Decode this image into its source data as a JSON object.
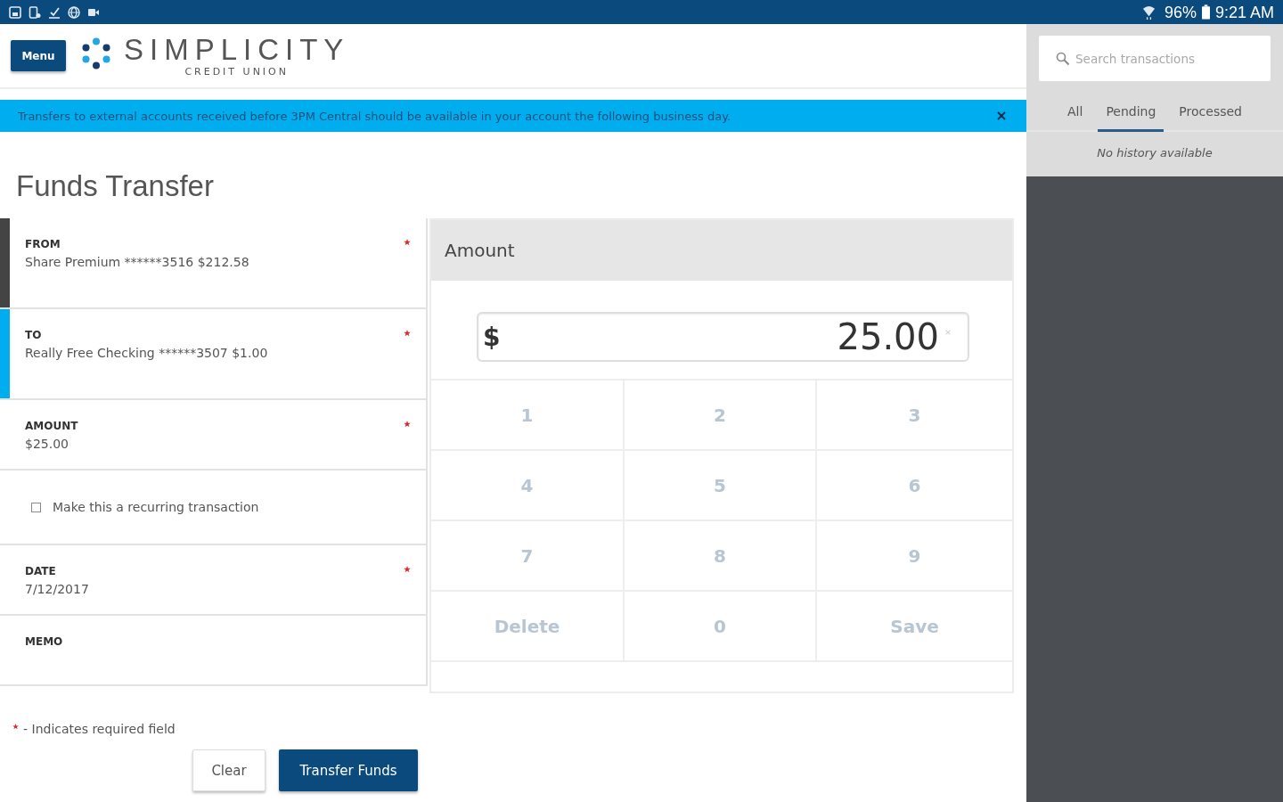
{
  "status_bar": {
    "battery": "96%",
    "time": "9:21 AM"
  },
  "header": {
    "menu_button": "Menu",
    "logo_name": "SIMPLICITY",
    "logo_tagline": "CREDIT UNION"
  },
  "banner": {
    "message": "Transfers to external accounts received before 3PM Central should be available in your account the following business day."
  },
  "page_title": "Funds Transfer",
  "form": {
    "fields": [
      {
        "kind": "field",
        "label": "FROM",
        "value": "Share Premium ******3516 $212.58",
        "required": true,
        "color": "#444444"
      },
      {
        "kind": "field",
        "label": "TO",
        "value": "Really Free Checking ******3507 $1.00",
        "required": true,
        "color": "#00aeef"
      },
      {
        "kind": "field",
        "label": "AMOUNT",
        "value": "$25.00",
        "required": true
      },
      {
        "kind": "checkbox",
        "label": "Make this a recurring transaction",
        "checked": false
      },
      {
        "kind": "field",
        "label": "DATE",
        "value": "7/12/2017",
        "required": true
      },
      {
        "kind": "field",
        "label": "MEMO",
        "required": false
      }
    ],
    "required_note": "- Indicates required field",
    "buttons": [
      {
        "label": "Clear",
        "kind": "secondary"
      },
      {
        "label": "Transfer Funds",
        "kind": "primary"
      }
    ]
  },
  "amount_pad": {
    "title": "Amount",
    "currency": "$",
    "value": "25.00",
    "keys": [
      "1",
      "2",
      "3",
      "4",
      "5",
      "6",
      "7",
      "8",
      "9",
      "Delete",
      "0",
      "Save"
    ]
  },
  "sidebar": {
    "search": {
      "placeholder": "Search transactions"
    },
    "tabs": [
      {
        "label": "All",
        "selected": false
      },
      {
        "label": "Pending",
        "selected": true
      },
      {
        "label": "Processed",
        "selected": false
      }
    ],
    "empty_message": "No history available"
  }
}
